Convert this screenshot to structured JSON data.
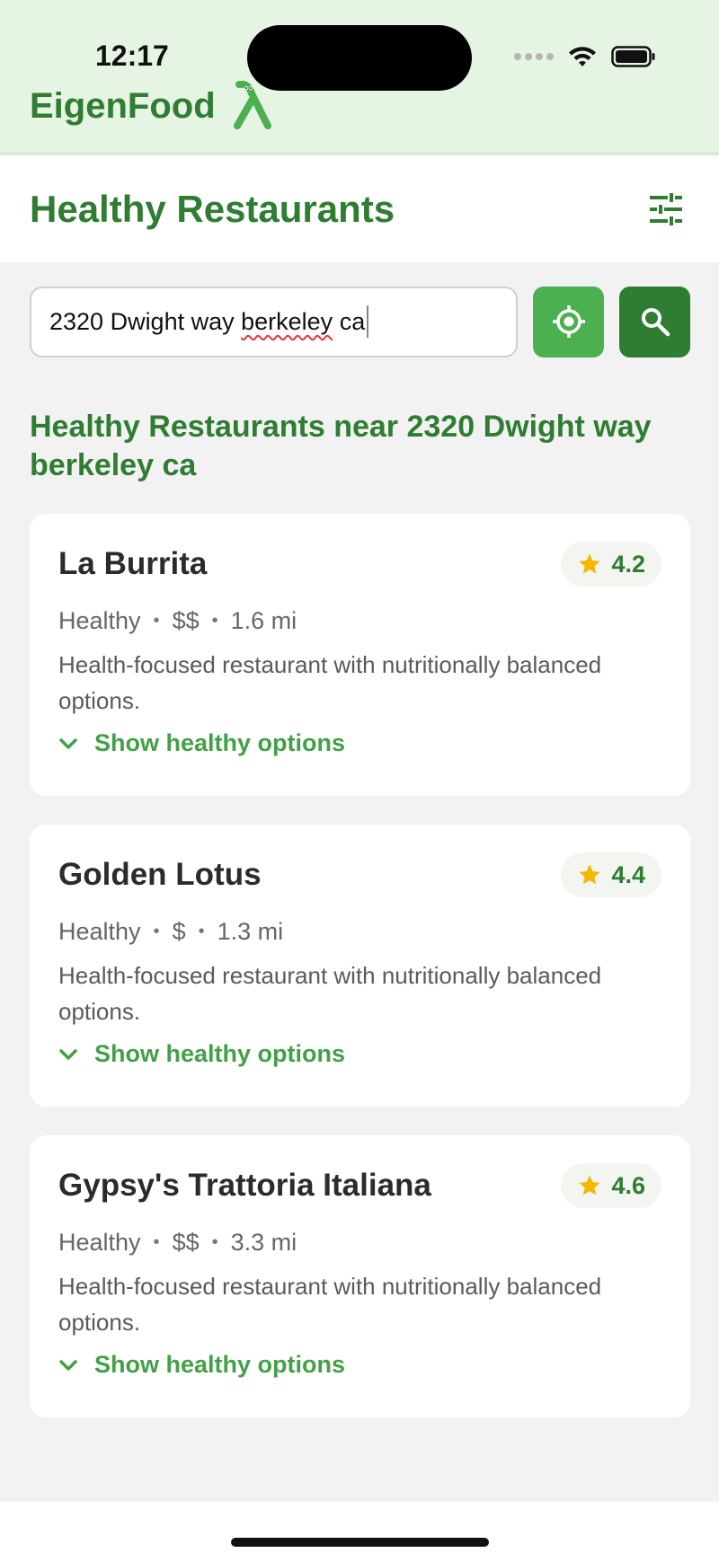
{
  "status_bar": {
    "time": "12:17"
  },
  "brand": {
    "name": "EigenFood"
  },
  "header": {
    "title": "Healthy Restaurants"
  },
  "search": {
    "value_prefix": "2320 Dwight way ",
    "value_misspelled": "berkeley",
    "value_suffix": " ca"
  },
  "results": {
    "heading": "Healthy Restaurants near 2320 Dwight way berkeley ca",
    "restaurants": [
      {
        "name": "La Burrita",
        "rating": "4.2",
        "category": "Healthy",
        "price": "$$",
        "distance": "1.6 mi",
        "description": "Health-focused restaurant with nutritionally balanced options.",
        "toggle_label": "Show healthy options"
      },
      {
        "name": "Golden Lotus",
        "rating": "4.4",
        "category": "Healthy",
        "price": "$",
        "distance": "1.3 mi",
        "description": "Health-focused restaurant with nutritionally balanced options.",
        "toggle_label": "Show healthy options"
      },
      {
        "name": "Gypsy's Trattoria Italiana",
        "rating": "4.6",
        "category": "Healthy",
        "price": "$$",
        "distance": "3.3 mi",
        "description": "Health-focused restaurant with nutritionally balanced options.",
        "toggle_label": "Show healthy options"
      }
    ]
  },
  "icons": {
    "brand_logo": "lambda-mascot-icon",
    "filter": "sliders-icon",
    "locate": "crosshair-location-icon",
    "search": "magnifier-icon",
    "rating": "star-icon",
    "toggle": "chevron-down-icon"
  },
  "colors": {
    "brand_green": "#2e7d32",
    "accent_green": "#4caf50",
    "link_green": "#43a047",
    "header_bg": "#e6f4e3",
    "star": "#f5b800"
  }
}
